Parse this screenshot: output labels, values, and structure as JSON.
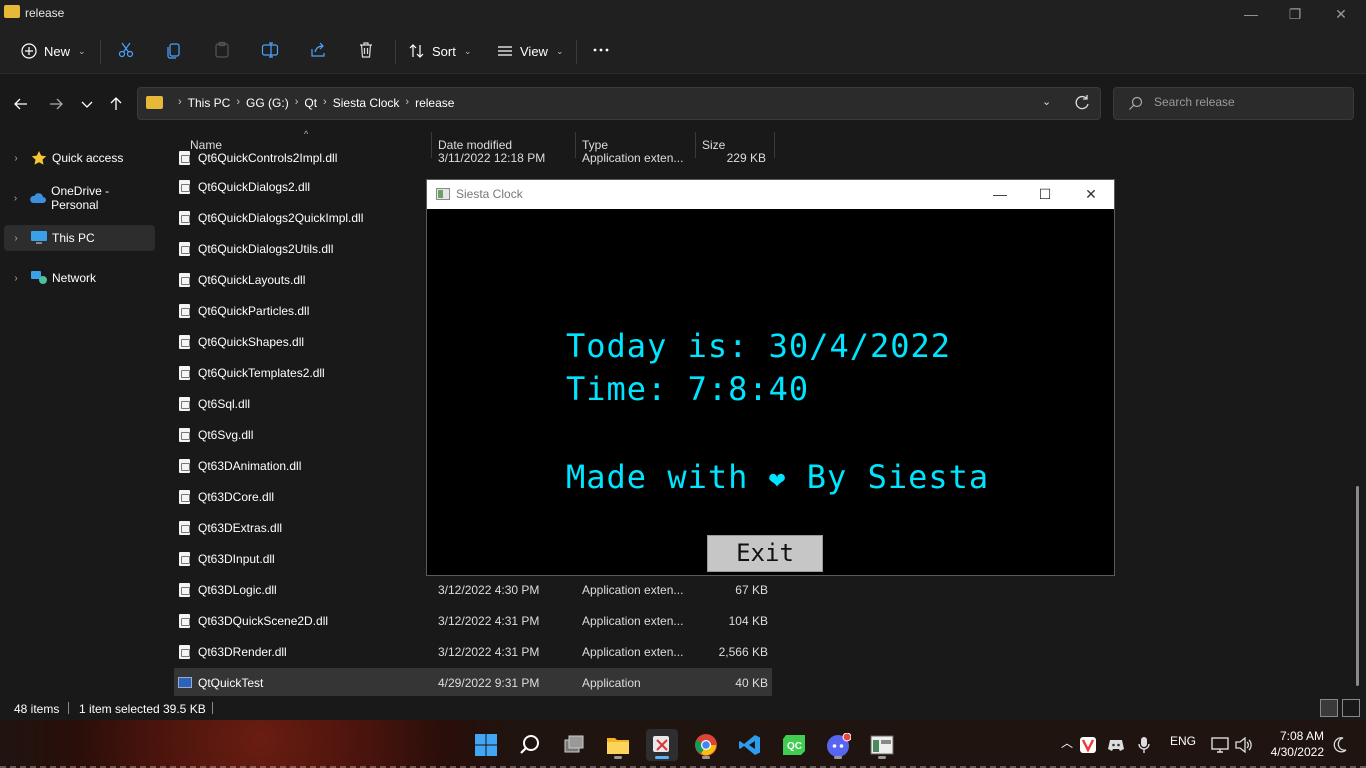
{
  "window": {
    "title": "release"
  },
  "toolbar": {
    "new_label": "New",
    "sort_label": "Sort",
    "view_label": "View"
  },
  "address": {
    "crumbs": [
      "This PC",
      "GG (G:)",
      "Qt",
      "Siesta Clock",
      "release"
    ]
  },
  "search": {
    "placeholder": "Search release"
  },
  "sidebar": {
    "items": [
      {
        "label": "Quick access",
        "icon": "star-icon"
      },
      {
        "label": "OneDrive - Personal",
        "icon": "cloud-icon"
      },
      {
        "label": "This PC",
        "icon": "monitor-icon",
        "selected": true
      },
      {
        "label": "Network",
        "icon": "network-icon"
      }
    ]
  },
  "columns": {
    "name": "Name",
    "date": "Date modified",
    "type": "Type",
    "size": "Size"
  },
  "files": [
    {
      "name": "Qt6QuickControls2Impl.dll",
      "date": "3/11/2022 12:18 PM",
      "type": "Application exten...",
      "size": "229 KB"
    },
    {
      "name": "Qt6QuickDialogs2.dll",
      "date": "",
      "type": "",
      "size": ""
    },
    {
      "name": "Qt6QuickDialogs2QuickImpl.dll",
      "date": "",
      "type": "",
      "size": ""
    },
    {
      "name": "Qt6QuickDialogs2Utils.dll",
      "date": "",
      "type": "",
      "size": ""
    },
    {
      "name": "Qt6QuickLayouts.dll",
      "date": "",
      "type": "",
      "size": ""
    },
    {
      "name": "Qt6QuickParticles.dll",
      "date": "",
      "type": "",
      "size": ""
    },
    {
      "name": "Qt6QuickShapes.dll",
      "date": "",
      "type": "",
      "size": ""
    },
    {
      "name": "Qt6QuickTemplates2.dll",
      "date": "",
      "type": "",
      "size": ""
    },
    {
      "name": "Qt6Sql.dll",
      "date": "",
      "type": "",
      "size": ""
    },
    {
      "name": "Qt6Svg.dll",
      "date": "",
      "type": "",
      "size": ""
    },
    {
      "name": "Qt63DAnimation.dll",
      "date": "",
      "type": "",
      "size": ""
    },
    {
      "name": "Qt63DCore.dll",
      "date": "",
      "type": "",
      "size": ""
    },
    {
      "name": "Qt63DExtras.dll",
      "date": "",
      "type": "",
      "size": ""
    },
    {
      "name": "Qt63DInput.dll",
      "date": "",
      "type": "",
      "size": ""
    },
    {
      "name": "Qt63DLogic.dll",
      "date": "3/12/2022 4:30 PM",
      "type": "Application exten...",
      "size": "67 KB"
    },
    {
      "name": "Qt63DQuickScene2D.dll",
      "date": "3/12/2022 4:31 PM",
      "type": "Application exten...",
      "size": "104 KB"
    },
    {
      "name": "Qt63DRender.dll",
      "date": "3/12/2022 4:31 PM",
      "type": "Application exten...",
      "size": "2,566 KB"
    },
    {
      "name": "QtQuickTest",
      "date": "4/29/2022 9:31 PM",
      "type": "Application",
      "size": "40 KB",
      "selected": true
    }
  ],
  "status": {
    "items": "48 items",
    "selected": "1 item selected",
    "size": "39.5 KB"
  },
  "siesta": {
    "title": "Siesta Clock",
    "today": "Today is: 30/4/2022",
    "time": "Time: 7:8:40",
    "made_prefix": "Made with",
    "heart": "❤",
    "made_suffix": "By Siesta",
    "exit_label": "Exit",
    "text_color": "#00e5ff"
  },
  "taskbar": {
    "lang": "ENG",
    "time": "7:08 AM",
    "date": "4/30/2022"
  }
}
